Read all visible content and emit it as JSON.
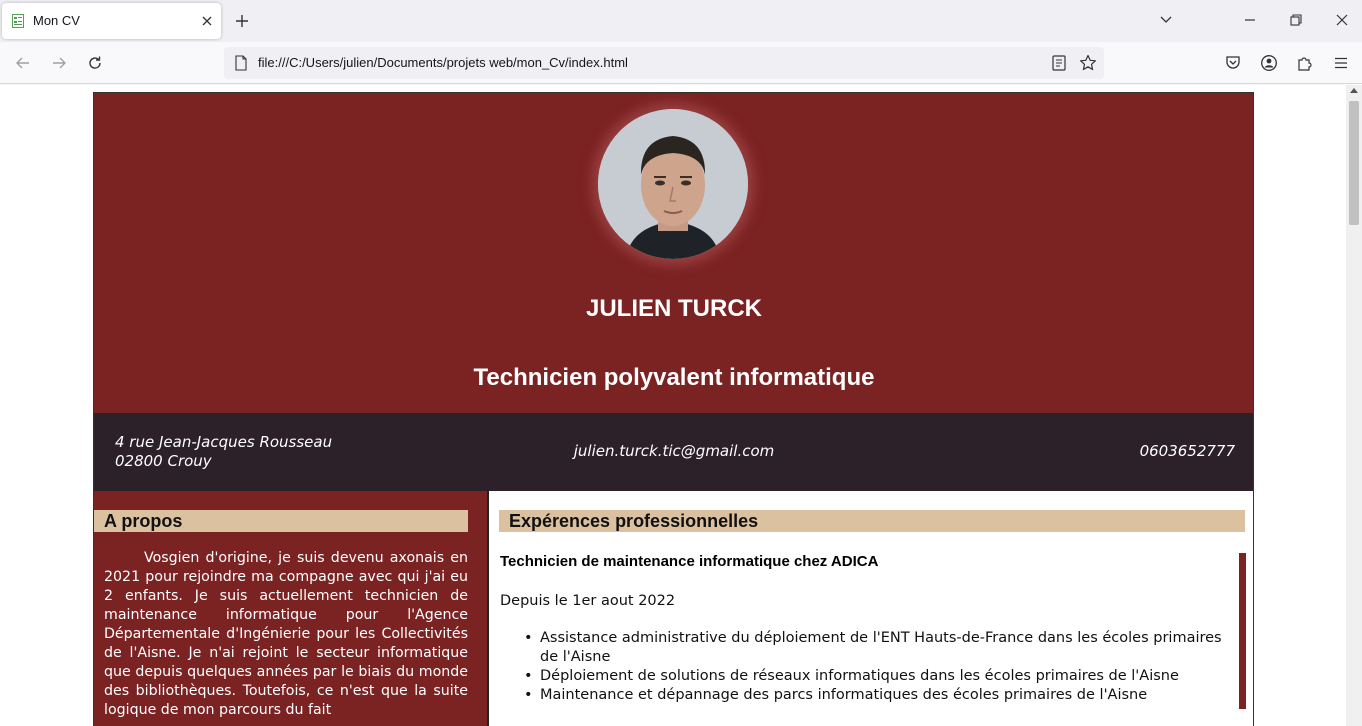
{
  "browser": {
    "tab_title": "Mon CV",
    "url": "file:///C:/Users/julien/Documents/projets web/mon_Cv/index.html"
  },
  "cv": {
    "name": "JULIEN TURCK",
    "job_title": "Technicien polyvalent informatique",
    "contact": {
      "address_line1": "4 rue Jean-Jacques Rousseau",
      "address_line2": "02800 Crouy",
      "email": "julien.turck.tic@gmail.com",
      "phone": "0603652777"
    },
    "about": {
      "heading": "A propos",
      "text": "Vosgien d'origine, je suis devenu axonais en 2021 pour rejoindre ma compagne avec qui j'ai eu 2 enfants. Je suis actuellement technicien de maintenance informatique pour l'Agence Départementale d'Ingénierie pour les Collectivités de l'Aisne. Je n'ai rejoint le secteur informatique que depuis quelques années par le biais du monde des bibliothèques. Toutefois, ce n'est que la suite logique de mon parcours du fait"
    },
    "experience": {
      "heading": "Expérences professionnelles",
      "job_title": "Technicien de maintenance informatique chez ADICA",
      "date": "Depuis le 1er aout 2022",
      "tasks": [
        "Assistance administrative du déploiement de l'ENT Hauts-de-France dans les écoles primaires de l'Aisne",
        "Déploiement de solutions de réseaux informatiques dans les écoles primaires de l'Aisne",
        "Maintenance et dépannage des parcs informatiques des écoles primaires de l'Aisne"
      ]
    }
  },
  "colors": {
    "brand_red": "#7b2223",
    "contact_bar": "#2c2029",
    "section_heading_bg": "#dcc1a1"
  },
  "icons": [
    "favicon-cv-icon",
    "close-icon",
    "plus-icon",
    "chevron-down-icon",
    "minimize-icon",
    "restore-icon",
    "close-window-icon",
    "back-arrow-icon",
    "forward-arrow-icon",
    "reload-icon",
    "page-icon",
    "reader-view-icon",
    "bookmark-star-icon",
    "pocket-icon",
    "account-icon",
    "extensions-icon",
    "menu-icon"
  ]
}
